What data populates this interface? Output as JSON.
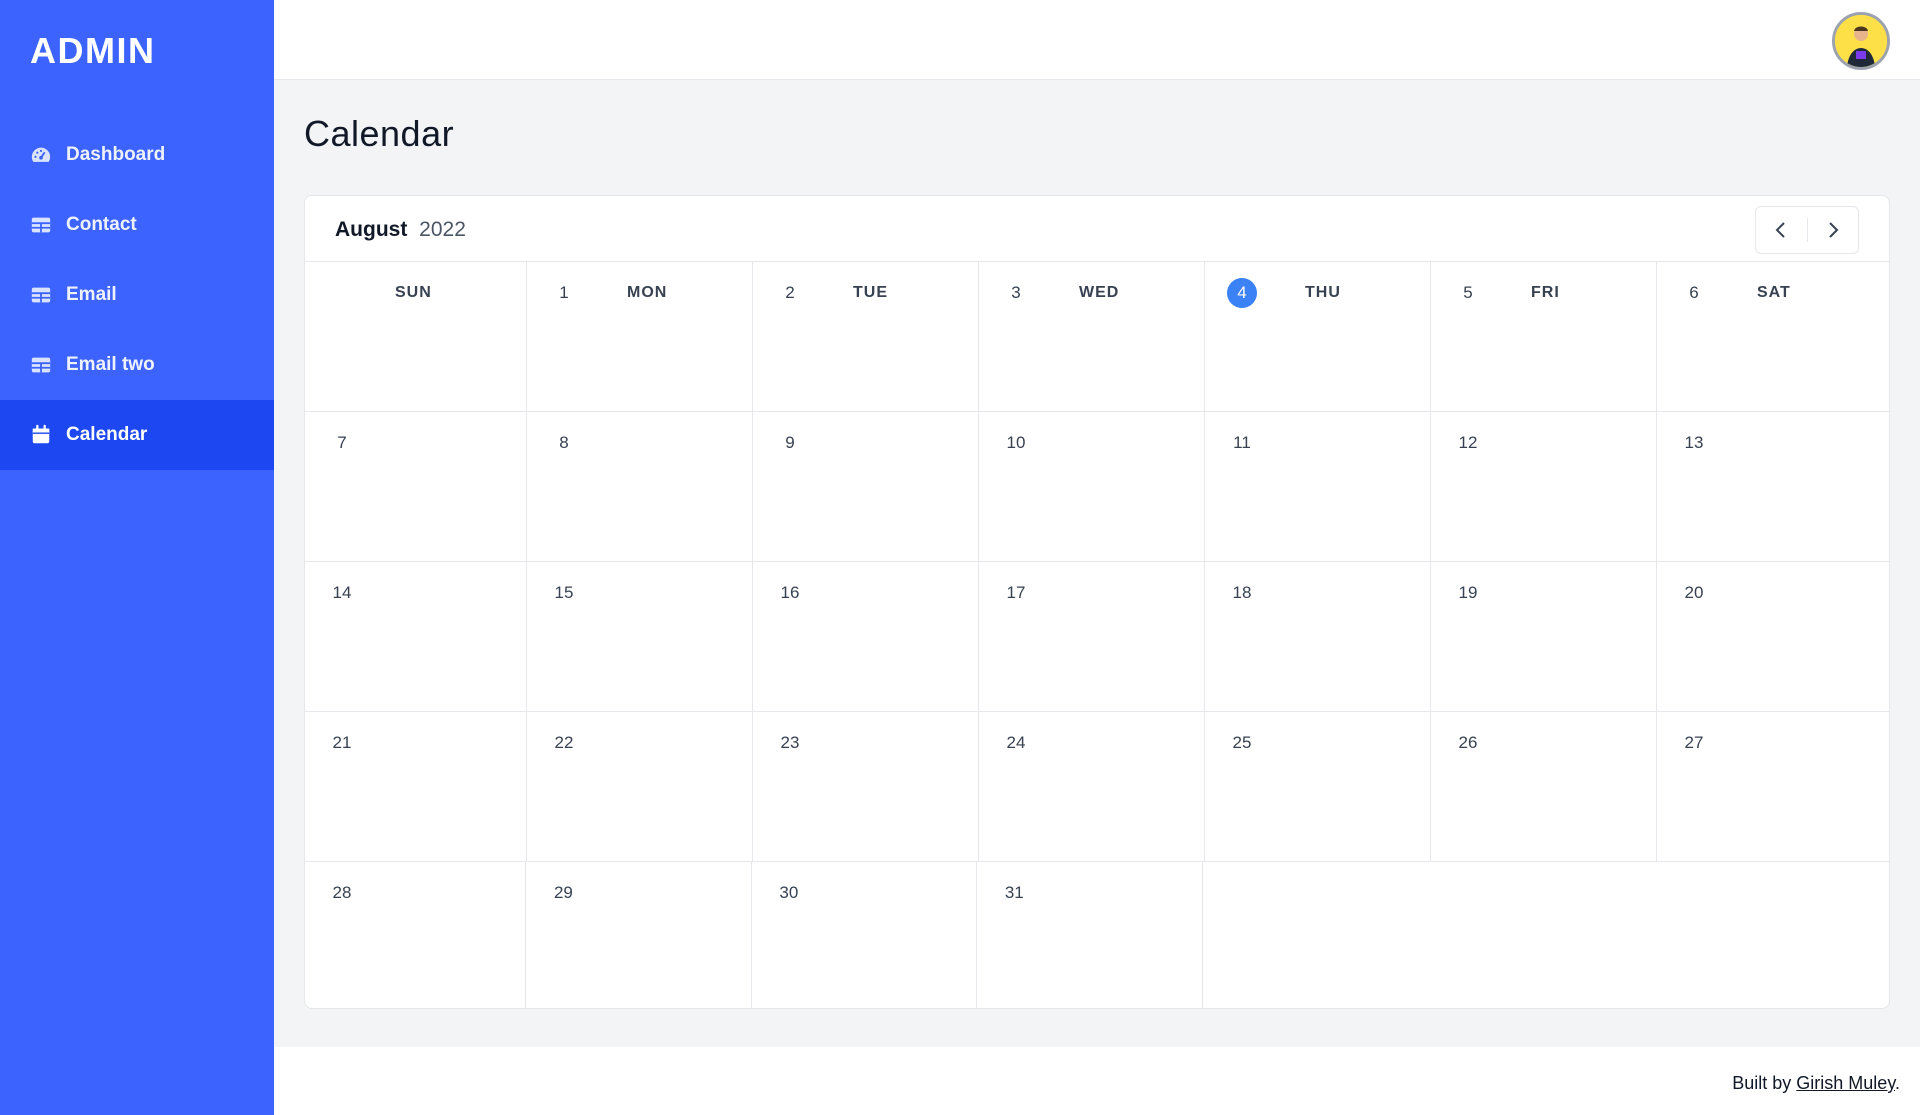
{
  "sidebar": {
    "brand": "ADMIN",
    "items": [
      {
        "label": "Dashboard",
        "icon": "dashboard-icon"
      },
      {
        "label": "Contact",
        "icon": "table-icon"
      },
      {
        "label": "Email",
        "icon": "table-icon"
      },
      {
        "label": "Email two",
        "icon": "table-icon"
      },
      {
        "label": "Calendar",
        "icon": "calendar-icon",
        "active": true
      }
    ],
    "colors": {
      "background": "#3d63ff",
      "active": "#1d47f0"
    }
  },
  "header": {
    "avatar": "user-avatar"
  },
  "page": {
    "title": "Calendar"
  },
  "calendar": {
    "month": "August",
    "year": "2022",
    "weekdays": [
      "SUN",
      "MON",
      "TUE",
      "WED",
      "THU",
      "FRI",
      "SAT"
    ],
    "today": "4",
    "weeks": [
      [
        "",
        "1",
        "2",
        "3",
        "4",
        "5",
        "6"
      ],
      [
        "7",
        "8",
        "9",
        "10",
        "11",
        "12",
        "13"
      ],
      [
        "14",
        "15",
        "16",
        "17",
        "18",
        "19",
        "20"
      ],
      [
        "21",
        "22",
        "23",
        "24",
        "25",
        "26",
        "27"
      ],
      [
        "28",
        "29",
        "30",
        "31",
        "",
        "",
        ""
      ]
    ],
    "today_color": "#3b82f6"
  },
  "footer": {
    "prefix": "Built by ",
    "author": "Girish Muley",
    "suffix": "."
  }
}
